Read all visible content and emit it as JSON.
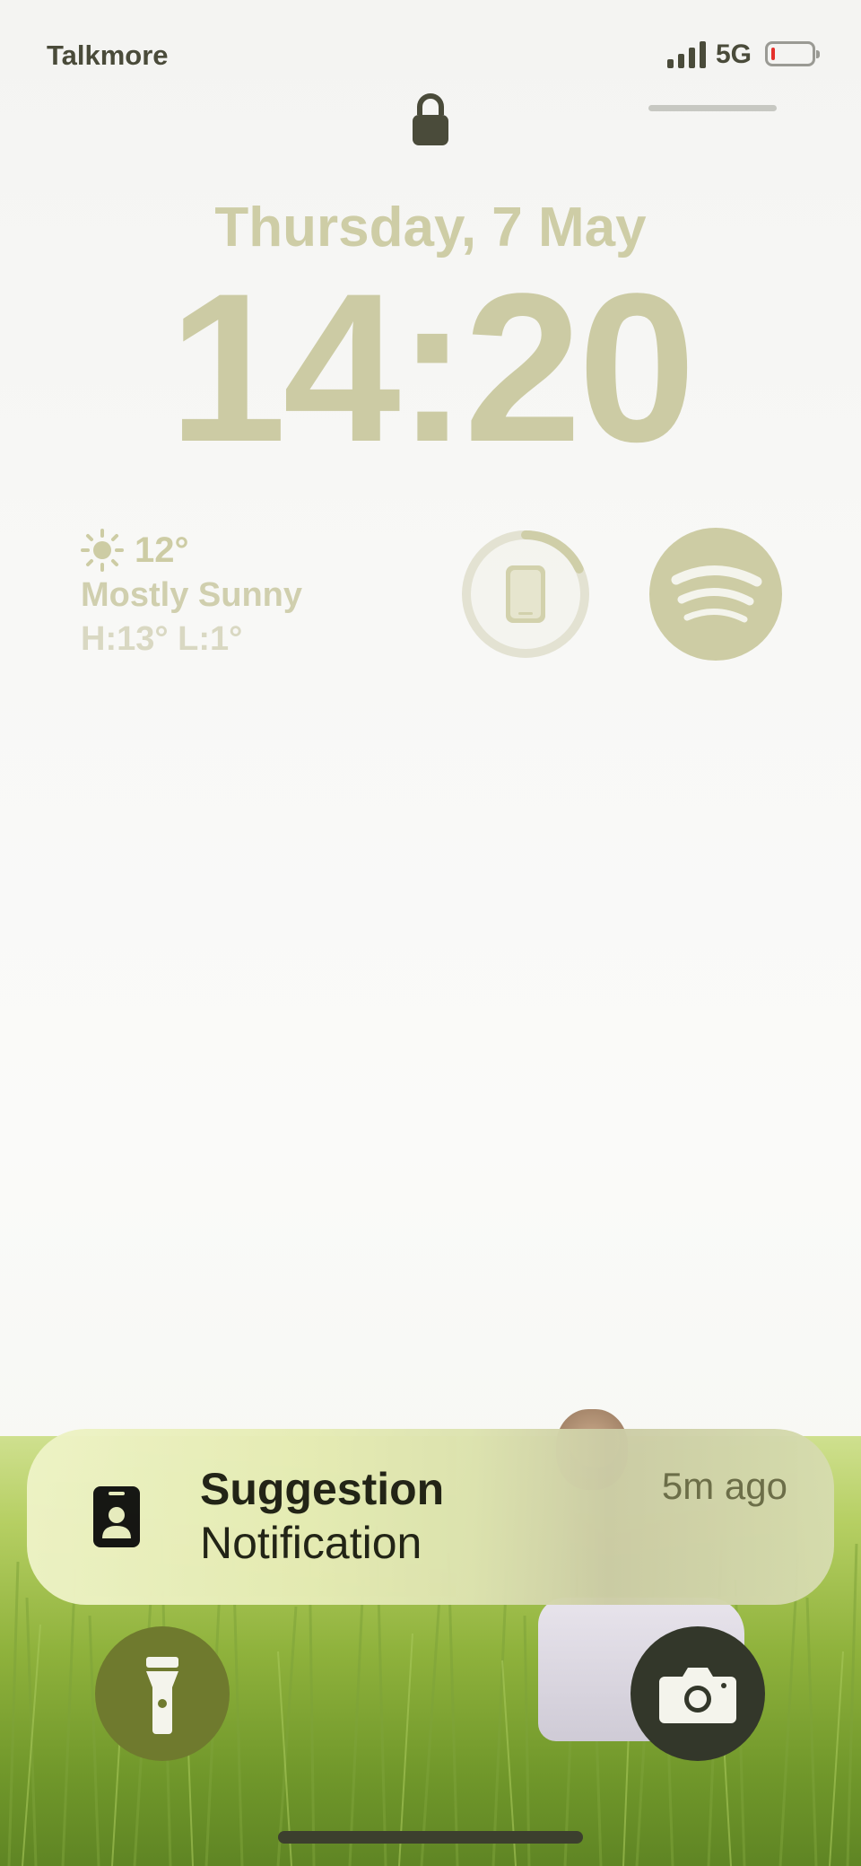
{
  "status_bar": {
    "carrier": "Talkmore",
    "network": "5G",
    "battery_level": 0.08,
    "battery_color": "#e5312c"
  },
  "lock_screen": {
    "lock_icon": "lock-icon",
    "date": "Thursday, 7 May",
    "time": "14:20"
  },
  "widgets": {
    "weather": {
      "icon": "sun-icon",
      "temperature": "12°",
      "condition": "Mostly Sunny",
      "high_low": "H:13° L:1°"
    },
    "device_battery": {
      "icon": "iphone-icon",
      "level": 0.18
    },
    "spotify": {
      "icon": "spotify-icon"
    }
  },
  "notification": {
    "icon": "contact-card-icon",
    "title": "Suggestion",
    "body": "Notification",
    "time": "5m ago"
  },
  "quick_actions": {
    "flashlight": {
      "icon": "flashlight-icon"
    },
    "camera": {
      "icon": "camera-icon"
    }
  },
  "colors": {
    "accent_text": "#cccba4",
    "flashlight_button": "#6f7a2e",
    "camera_button": "#33372a"
  }
}
